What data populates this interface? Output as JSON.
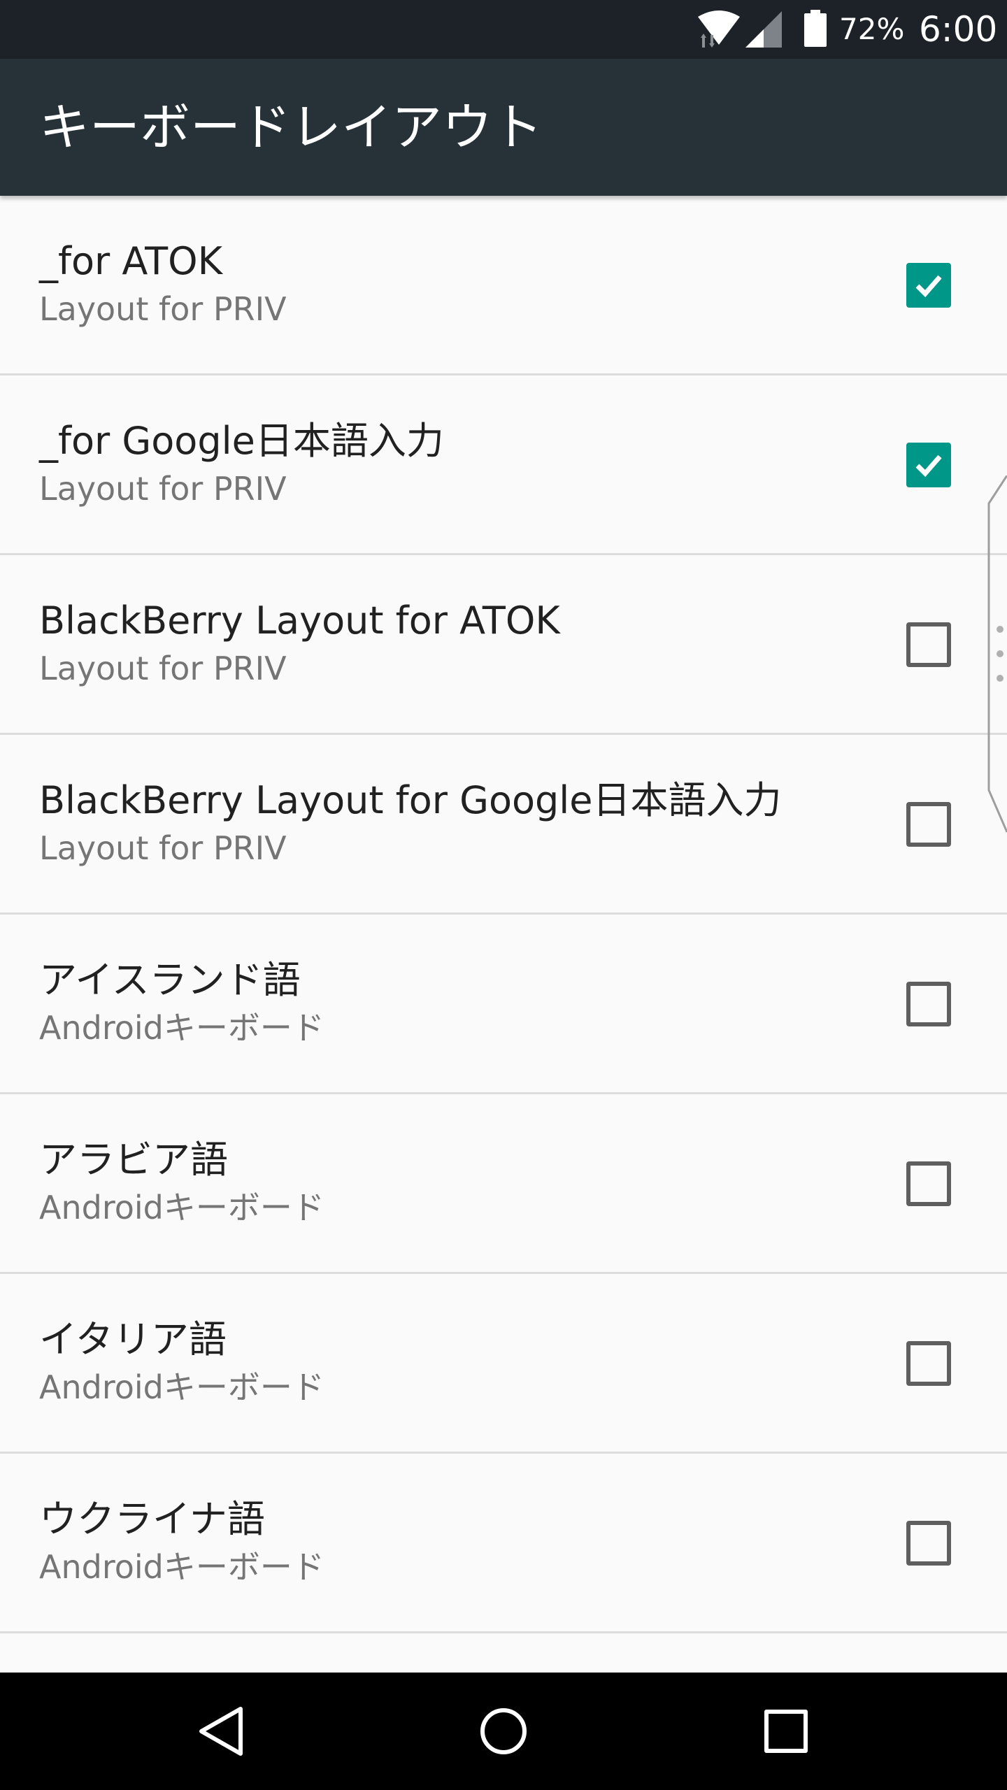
{
  "status_bar": {
    "battery_percent": "72%",
    "time": "6:00",
    "icons": [
      "wifi-icon",
      "cell-signal-icon",
      "battery-icon"
    ]
  },
  "app_bar": {
    "title": "キーボードレイアウト"
  },
  "colors": {
    "status_bar": "#1c2227",
    "app_bar": "#263238",
    "accent": "#009688",
    "background": "#fafafa"
  },
  "layouts": [
    {
      "label": "_for ATOK",
      "summary": "Layout for PRIV",
      "checked": true
    },
    {
      "label": "_for Google日本語入力",
      "summary": "Layout for PRIV",
      "checked": true
    },
    {
      "label": "BlackBerry Layout for ATOK",
      "summary": "Layout for PRIV",
      "checked": false
    },
    {
      "label": "BlackBerry Layout for Google日本語入力",
      "summary": "Layout for PRIV",
      "checked": false
    },
    {
      "label": "アイスランド語",
      "summary": "Androidキーボード",
      "checked": false
    },
    {
      "label": "アラビア語",
      "summary": "Androidキーボード",
      "checked": false
    },
    {
      "label": "イタリア語",
      "summary": "Androidキーボード",
      "checked": false
    },
    {
      "label": "ウクライナ語",
      "summary": "Androidキーボード",
      "checked": false
    }
  ],
  "nav_bar": {
    "icons": [
      "back-icon",
      "home-icon",
      "recents-icon"
    ]
  }
}
